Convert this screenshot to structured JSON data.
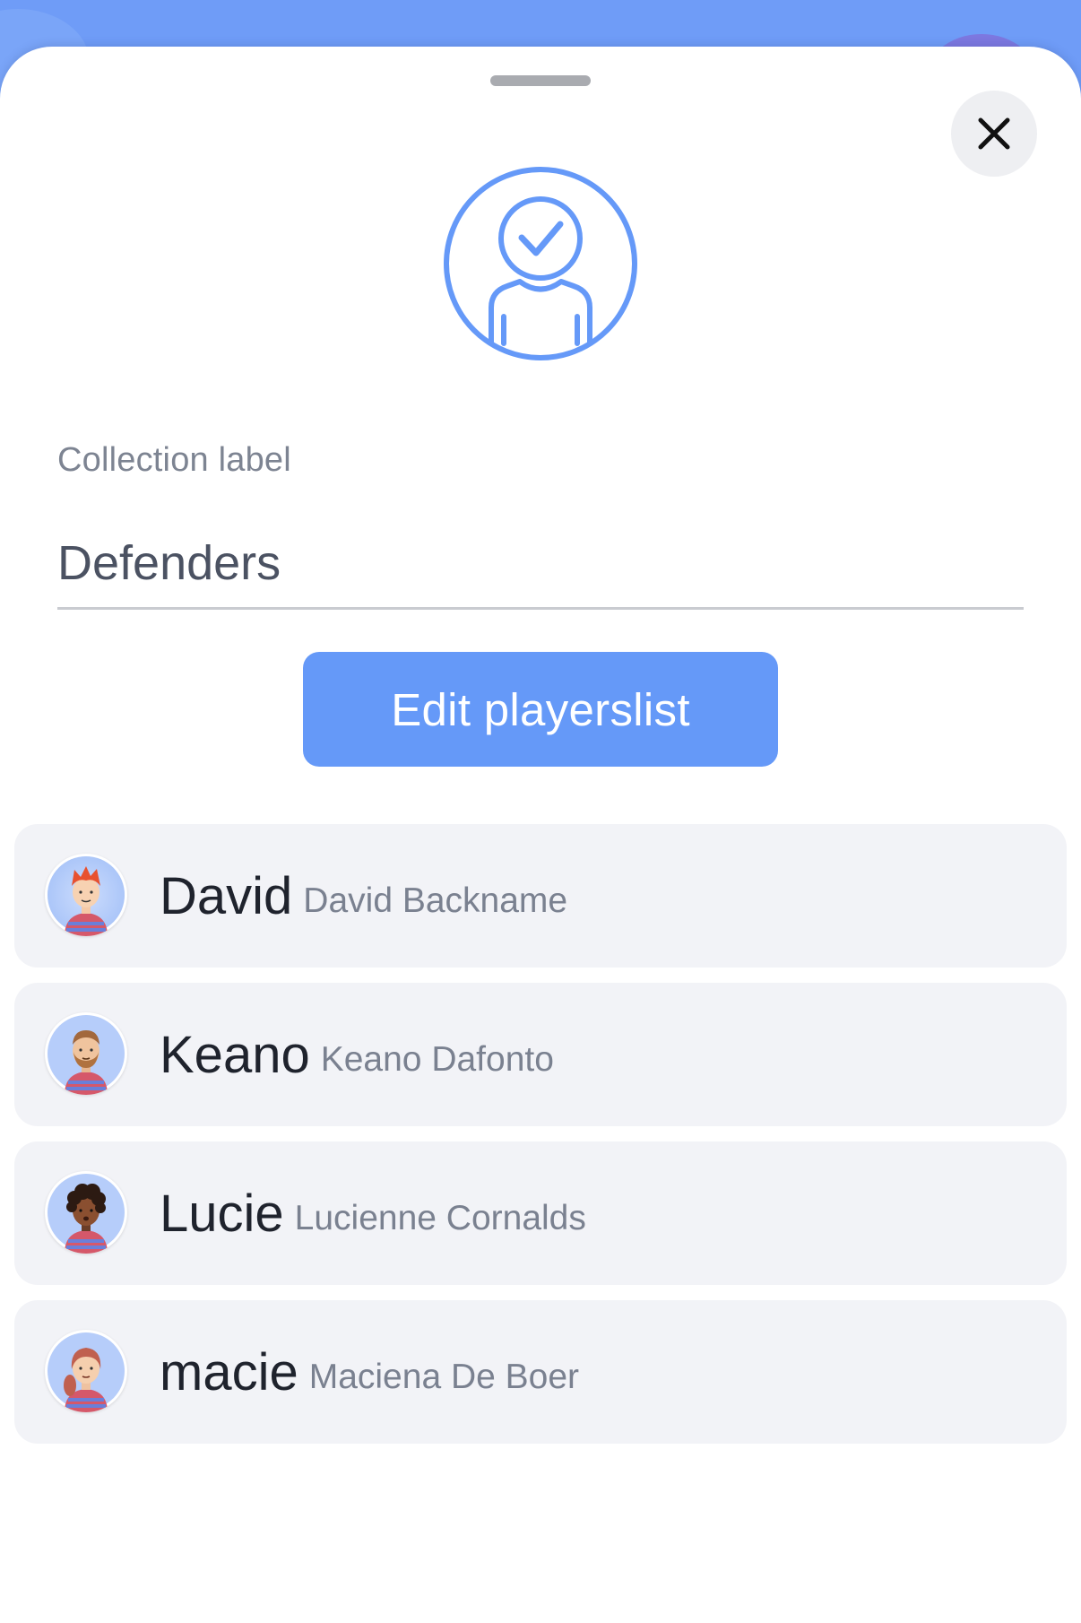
{
  "colors": {
    "accent": "#6599f8",
    "backdrop": "#6f9cf7",
    "card_bg": "#f2f3f7",
    "label_gray": "#7d8492"
  },
  "header": {
    "close_icon": "close-icon",
    "hero_icon": "user-check-icon"
  },
  "form": {
    "collection_label": "Collection label",
    "collection_value": "Defenders"
  },
  "actions": {
    "edit_label": "Edit playerslist"
  },
  "players": [
    {
      "nickname": "David",
      "full_name": "David Backname",
      "avatar": "red-hair-boy-avatar"
    },
    {
      "nickname": "Keano",
      "full_name": "Keano Dafonto",
      "avatar": "bearded-man-avatar"
    },
    {
      "nickname": "Lucie",
      "full_name": "Lucienne Cornalds",
      "avatar": "curly-hair-avatar"
    },
    {
      "nickname": "macie",
      "full_name": "Maciena De Boer",
      "avatar": "ponytail-girl-avatar"
    }
  ]
}
